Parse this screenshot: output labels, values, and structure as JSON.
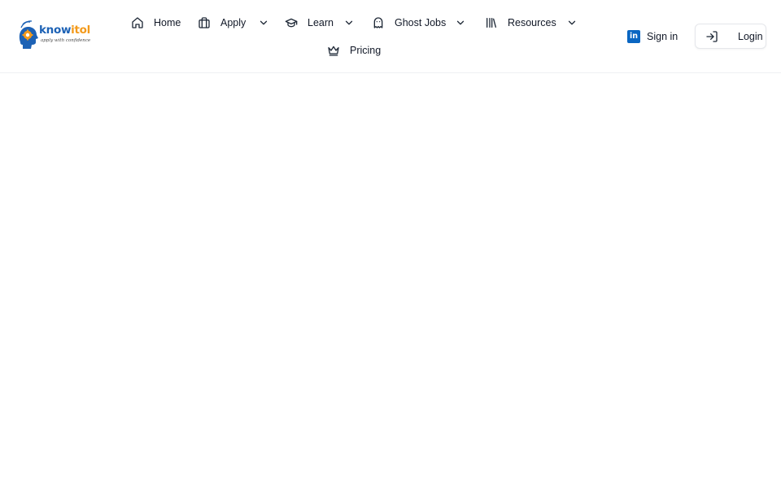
{
  "brand": {
    "name_part1": "know",
    "name_part2": "itol",
    "tagline": "apply with confidence",
    "colors": {
      "blue": "#1d62b5",
      "orange": "#f39a1b"
    }
  },
  "nav": {
    "items": [
      {
        "label": "Home",
        "icon": "home-icon",
        "dropdown": false
      },
      {
        "label": "Apply",
        "icon": "briefcase-icon",
        "dropdown": true
      },
      {
        "label": "Learn",
        "icon": "graduation-cap-icon",
        "dropdown": true
      },
      {
        "label": "Ghost Jobs",
        "icon": "ghost-icon",
        "dropdown": true
      },
      {
        "label": "Resources",
        "icon": "library-icon",
        "dropdown": true
      },
      {
        "label": "Pricing",
        "icon": "crown-icon",
        "dropdown": false
      }
    ]
  },
  "auth": {
    "signin_label": "Sign in",
    "signin_icon": "linkedin-icon",
    "login_label": "Login",
    "login_icon": "log-in-icon",
    "linkedin_color": "#0a66c2"
  }
}
